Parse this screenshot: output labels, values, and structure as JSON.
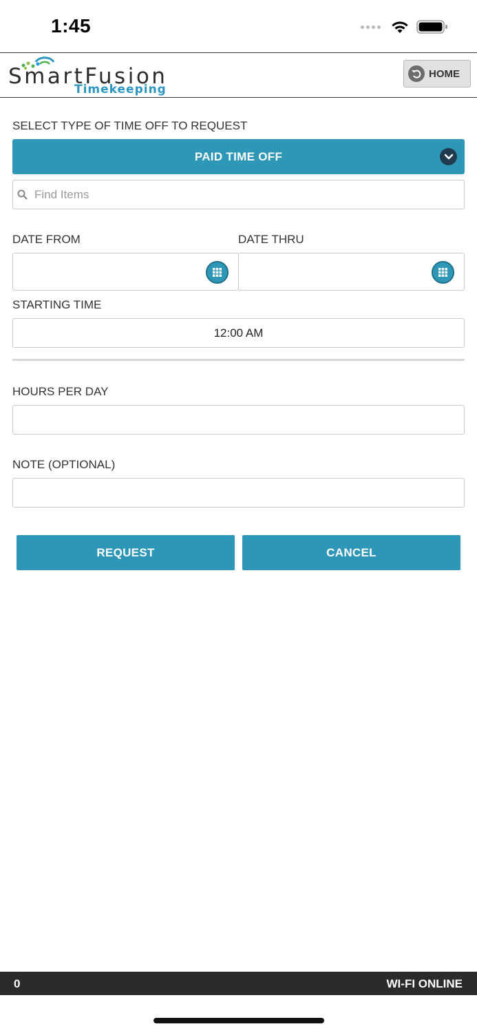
{
  "status_bar": {
    "time": "1:45"
  },
  "header": {
    "logo_main": "SmartFusion",
    "logo_sub": "Timekeeping",
    "home_label": "HOME"
  },
  "form": {
    "type_label": "SELECT TYPE OF TIME OFF TO REQUEST",
    "type_selected": "PAID TIME OFF",
    "search_placeholder": "Find Items",
    "date_from_label": "DATE FROM",
    "date_from_value": "",
    "date_thru_label": "DATE THRU",
    "date_thru_value": "",
    "starting_time_label": "STARTING TIME",
    "starting_time_value": "12:00 AM",
    "hours_label": "HOURS PER DAY",
    "hours_value": "",
    "note_label": "NOTE (OPTIONAL)",
    "note_value": ""
  },
  "actions": {
    "request_label": "REQUEST",
    "cancel_label": "CANCEL"
  },
  "footer": {
    "count": "0",
    "connection": "WI-FI ONLINE"
  },
  "colors": {
    "accent": "#2e97b7",
    "footer_bg": "#2b2b2b",
    "logo_sub": "#2e97c0"
  },
  "icons": {
    "dropdown": "chevron-down-icon",
    "search": "search-icon",
    "calendar": "calendar-icon",
    "home": "back-arrow-icon"
  }
}
